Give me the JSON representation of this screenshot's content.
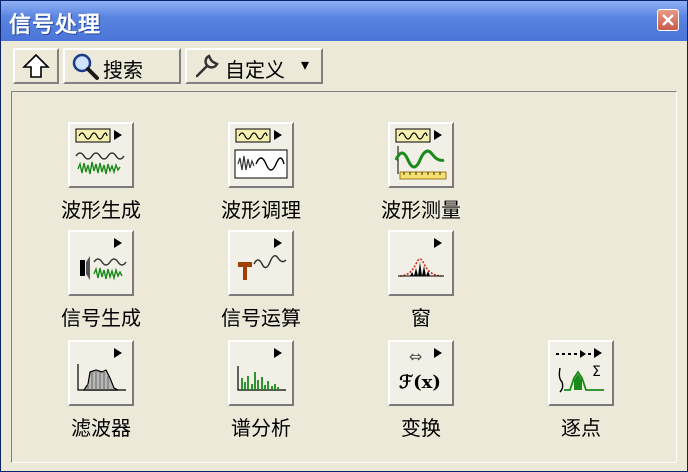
{
  "window": {
    "title": "信号处理"
  },
  "toolbar": {
    "search_label": "搜索",
    "customize_label": "自定义",
    "customize_arrow": "▾"
  },
  "palette": {
    "items": [
      {
        "label": "波形生成",
        "icon": "waveform-generation-icon"
      },
      {
        "label": "波形调理",
        "icon": "waveform-conditioning-icon"
      },
      {
        "label": "波形测量",
        "icon": "waveform-measurement-icon"
      },
      {
        "label": "信号生成",
        "icon": "signal-generation-icon"
      },
      {
        "label": "信号运算",
        "icon": "signal-operation-icon"
      },
      {
        "label": "窗",
        "icon": "window-function-icon"
      },
      {
        "label": "滤波器",
        "icon": "filter-icon"
      },
      {
        "label": "谱分析",
        "icon": "spectral-analysis-icon"
      },
      {
        "label": "变换",
        "icon": "transform-icon"
      },
      {
        "label": "逐点",
        "icon": "point-by-point-icon"
      }
    ]
  },
  "icon_text": {
    "transform_symbol": "ℱ(x)",
    "transform_arrow": "⇔",
    "sigma": "Σ"
  },
  "colors": {
    "title_bar": "#5a84e0",
    "window_bg": "#ece9d8",
    "wave_green": "#1a8a1a",
    "window_red": "#d03020"
  }
}
